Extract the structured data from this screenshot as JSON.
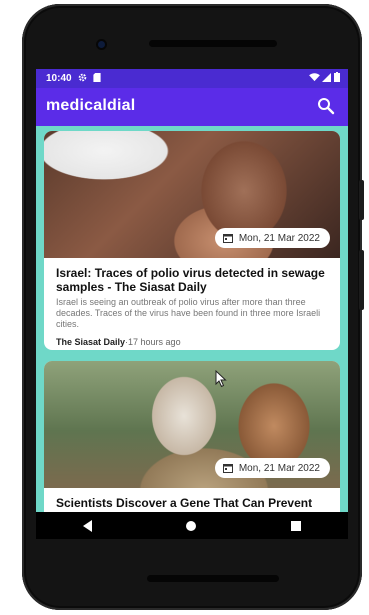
{
  "status": {
    "time": "10:40",
    "left_icons": [
      "gear-icon",
      "sd-card-icon"
    ],
    "right_icons": [
      "wifi-icon",
      "signal-icon",
      "battery-icon"
    ]
  },
  "appbar": {
    "title": "medicaldial",
    "search_icon": "search-icon"
  },
  "articles": [
    {
      "date": "Mon, 21 Mar 2022",
      "title": "Israel: Traces of polio virus detected in sewage samples - The Siasat Daily",
      "description": "Israel is seeing an outbreak of polio virus after more than three decades. Traces of the virus have been found in three more Israeli cities.",
      "source": "The Siasat Daily",
      "time": "·17 hours ago"
    },
    {
      "date": "Mon, 21 Mar 2022",
      "title": "Scientists Discover a Gene That Can Prevent"
    }
  ],
  "navbar": {
    "icons": [
      "back-icon",
      "home-icon",
      "recents-icon"
    ]
  },
  "colors": {
    "status_bar": "#4a2bd1",
    "app_bar": "#5b2ce8",
    "list_background": "#6fd8c8"
  }
}
